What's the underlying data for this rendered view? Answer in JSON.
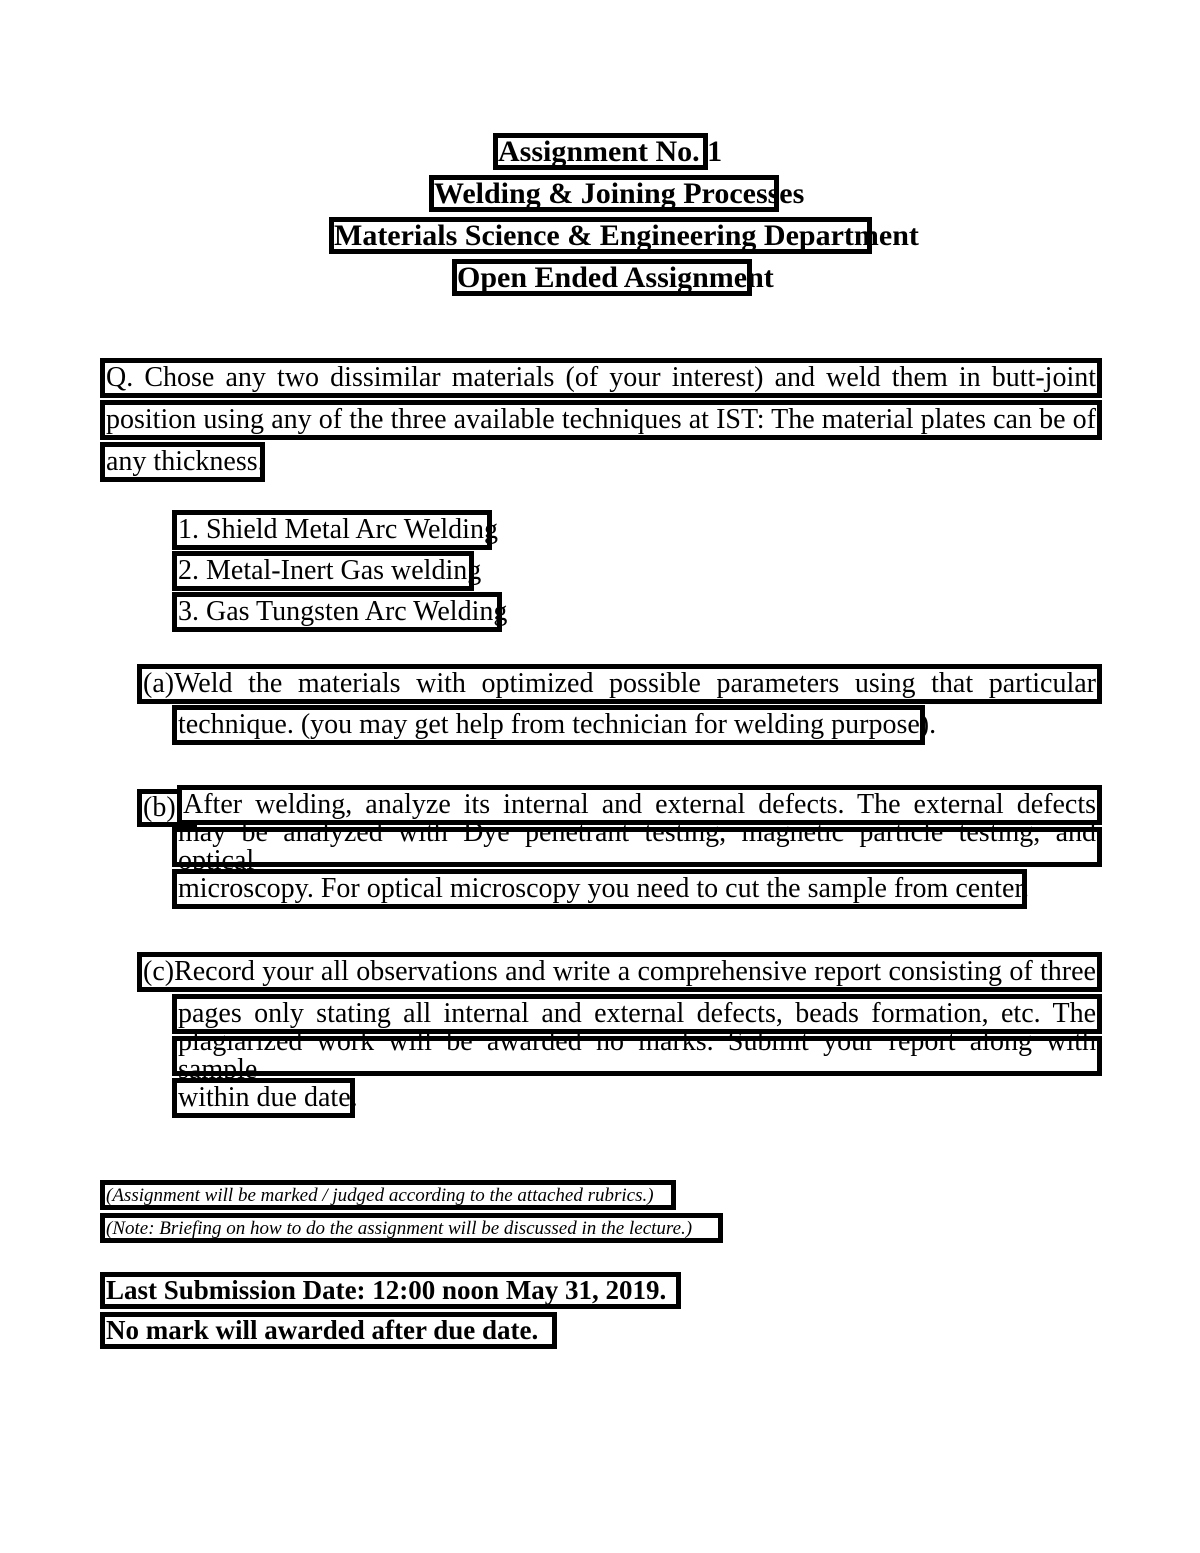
{
  "document": {
    "title": "Assignment No. 1",
    "page_background": "#ffffff",
    "text_color": "#000000",
    "box_border_color": "#000000"
  },
  "header": {
    "lines": [
      {
        "text": "Assignment No. 1"
      },
      {
        "text": "Welding & Joining Processes"
      },
      {
        "text": "Materials Science & Engineering Department"
      },
      {
        "text": "Open Ended Assignment"
      }
    ]
  },
  "question": {
    "lines": [
      {
        "text": "Q. Chose any two dissimilar materials (of your interest) and weld them in butt-joint"
      },
      {
        "text": "position using any of the three available techniques at IST: The material plates can be of"
      },
      {
        "text": "any thickness."
      }
    ]
  },
  "techniques": {
    "items": [
      {
        "text": "1. Shield Metal Arc Welding"
      },
      {
        "text": "2. Metal-Inert Gas welding"
      },
      {
        "text": "3. Gas Tungsten Arc Welding"
      }
    ]
  },
  "part_a": {
    "lines": [
      {
        "text": "(a)Weld the materials with optimized possible parameters using that particular"
      },
      {
        "text": "technique. (you may get help from technician for welding purpose)."
      }
    ]
  },
  "part_b": {
    "label": "(b)",
    "lines": [
      {
        "text": "After welding, analyze its internal and external defects. The external defects"
      },
      {
        "text": "may be analyzed with Dye penetrant testing, magnetic particle testing, and optical"
      },
      {
        "text": "microscopy. For optical microscopy you need to cut the sample from center."
      }
    ]
  },
  "part_c": {
    "lines": [
      {
        "text": "(c)Record your all observations and write a comprehensive report consisting of three"
      },
      {
        "text": "pages only stating all internal and external defects, beads formation, etc. The"
      },
      {
        "text": "plagiarized work will be awarded no marks. Submit your report along with sample"
      },
      {
        "text": "within due date."
      }
    ]
  },
  "notes": {
    "lines": [
      {
        "text": "(Assignment will be marked / judged according to the attached rubrics.)"
      },
      {
        "text": "(Note: Briefing on how to do the assignment will be discussed in the lecture.)"
      }
    ]
  },
  "footer": {
    "lines": [
      {
        "text": "Last Submission Date: 12:00 noon May 31, 2019."
      },
      {
        "text": "No mark will awarded after due date."
      }
    ]
  }
}
